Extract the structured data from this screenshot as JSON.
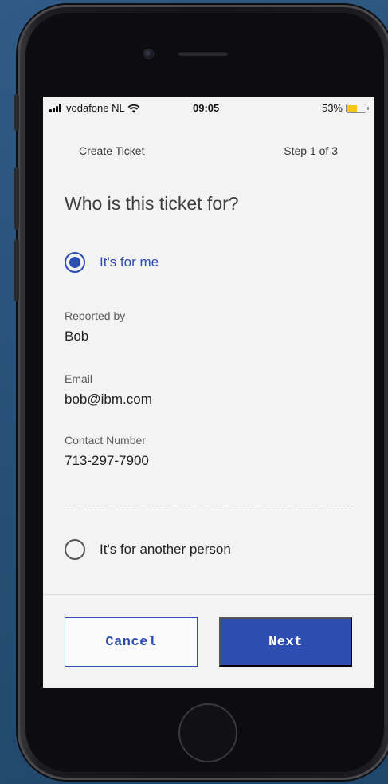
{
  "status_bar": {
    "carrier": "vodafone NL",
    "time": "09:05",
    "battery_percent_label": "53%",
    "battery_level": 0.53
  },
  "header": {
    "title": "Create Ticket",
    "step": "Step 1 of 3"
  },
  "question": "Who is this ticket for?",
  "options": [
    {
      "label": "It's for me",
      "selected": true
    },
    {
      "label": "It's for another person",
      "selected": false
    }
  ],
  "fields": [
    {
      "label": "Reported by",
      "value": "Bob"
    },
    {
      "label": "Email",
      "value": "bob@ibm.com"
    },
    {
      "label": "Contact Number",
      "value": "713-297-7900"
    }
  ],
  "buttons": {
    "cancel": "Cancel",
    "next": "Next"
  },
  "colors": {
    "accent": "#2d4db1",
    "battery": "#f5c518"
  }
}
